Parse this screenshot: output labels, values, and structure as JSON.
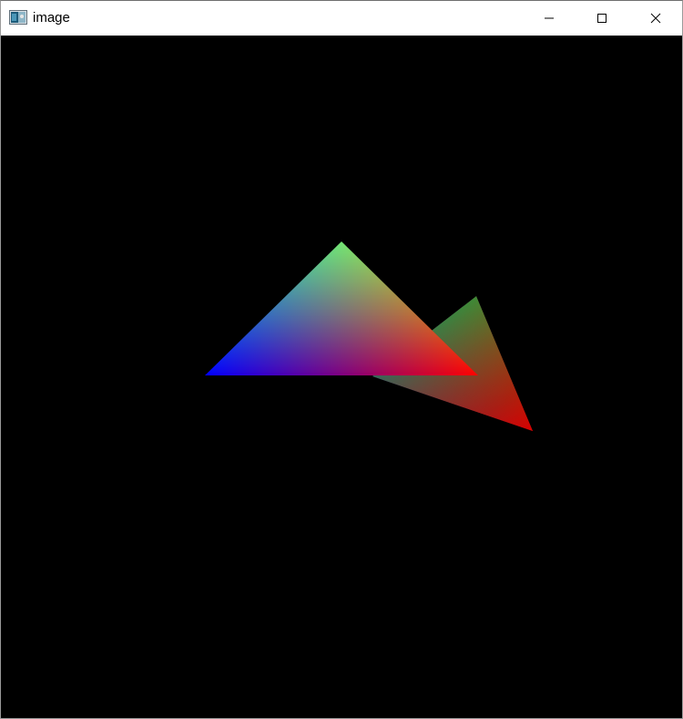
{
  "window": {
    "title": "image",
    "background_color": "#000000",
    "icons": {
      "app": "image-viewer-icon",
      "minimize": "minimize-icon",
      "maximize": "maximize-icon",
      "close": "close-icon"
    }
  },
  "scene": {
    "shape": "two overlapping triangles with interpolated vertex colors",
    "vertex_colors": {
      "red": "#ff0000",
      "green": "#00ff00",
      "blue": "#0000ff"
    }
  }
}
